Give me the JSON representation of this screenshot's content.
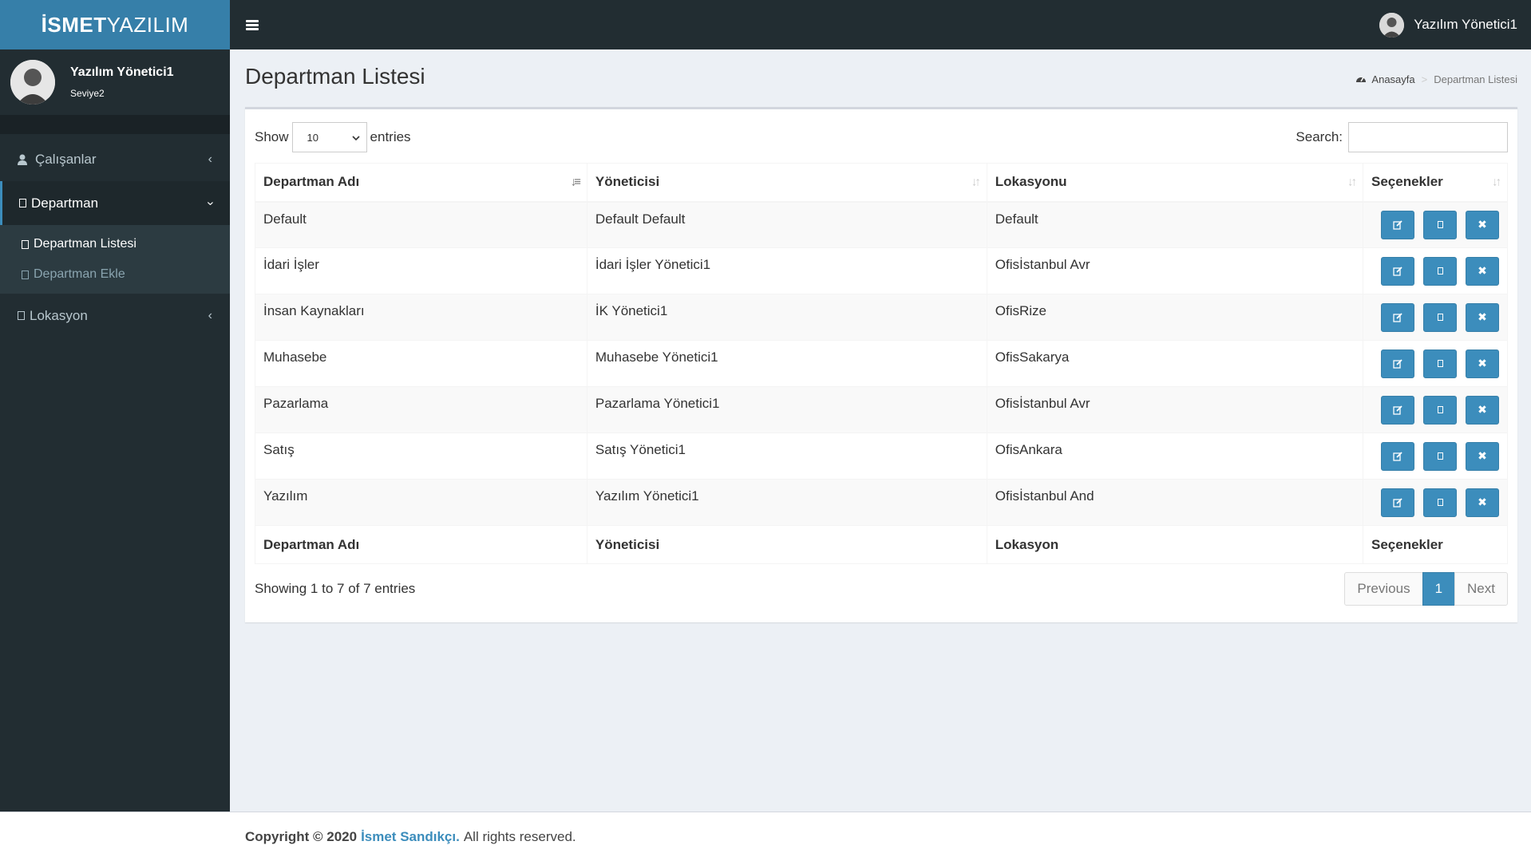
{
  "brand": {
    "bold": "İSMET",
    "light": "YAZILIM"
  },
  "navbar": {
    "user_name": "Yazılım Yönetici1"
  },
  "sidebar": {
    "user_name": "Yazılım Yönetici1",
    "user_level": "Seviye2",
    "menu": [
      {
        "label": "Çalışanlar",
        "icon": "user-icon"
      },
      {
        "label": "Departman",
        "icon": "square-icon",
        "submenu": [
          "Departman Listesi",
          "Departman Ekle"
        ]
      },
      {
        "label": "Lokasyon",
        "icon": "square-icon"
      }
    ]
  },
  "page": {
    "title": "Departman Listesi",
    "breadcrumb": {
      "home": "Anasayfa",
      "current": "Departman Listesi"
    }
  },
  "datatable": {
    "show_label": "Show",
    "entries_label": "entries",
    "length_value": "10",
    "search_label": "Search:",
    "columns": [
      "Departman Adı",
      "Yöneticisi",
      "Lokasyonu",
      "Seçenekler"
    ],
    "footer_columns": [
      "Departman Adı",
      "Yöneticisi",
      "Lokasyon",
      "Seçenekler"
    ],
    "rows": [
      [
        "Default",
        "Default Default",
        "Default"
      ],
      [
        "İdari İşler",
        "İdari İşler Yönetici1",
        "Ofisİstanbul Avr"
      ],
      [
        "İnsan Kaynakları",
        "İK Yönetici1",
        "OfisRize"
      ],
      [
        "Muhasebe",
        "Muhasebe Yönetici1",
        "OfisSakarya"
      ],
      [
        "Pazarlama",
        "Pazarlama Yönetici1",
        "Ofisİstanbul Avr"
      ],
      [
        "Satış",
        "Satış Yönetici1",
        "OfisAnkara"
      ],
      [
        "Yazılım",
        "Yazılım Yönetici1",
        "Ofisİstanbul And"
      ]
    ],
    "info": "Showing 1 to 7 of 7 entries",
    "pagination": {
      "previous": "Previous",
      "current": "1",
      "next": "Next"
    }
  },
  "footer": {
    "copyright": "Copyright © 2020",
    "author": "İsmet Sandıkçı.",
    "rights": "All rights reserved."
  },
  "colors": {
    "primary": "#3c8dbc",
    "sidebar_bg": "#222d32",
    "logo_bg": "#367fa9"
  }
}
